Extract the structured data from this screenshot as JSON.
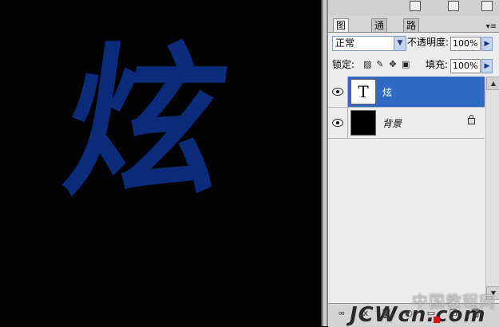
{
  "canvas": {
    "glyph": "炫"
  },
  "tabs": [
    {
      "label": "图层",
      "active": true,
      "close": "×"
    },
    {
      "label": "通道",
      "active": false
    },
    {
      "label": "路径",
      "active": false
    }
  ],
  "blend": {
    "mode": "正常"
  },
  "opacity": {
    "label": "不透明度:",
    "value": "100%"
  },
  "lock": {
    "label": "锁定:"
  },
  "fill": {
    "label": "填充:",
    "value": "100%"
  },
  "layers": [
    {
      "name": "炫",
      "thumb": "T",
      "selected": true
    },
    {
      "name": "背景",
      "selected": false
    }
  ],
  "watermark": {
    "cn": "中国教程网",
    "en": "JCWcn.com"
  },
  "icons": {
    "top": [
      "panel-menu-icon-1",
      "panel-menu-icon-2",
      "panel-menu-icon-3"
    ],
    "lock": [
      "lock-transparent-icon",
      "lock-image-icon",
      "lock-position-icon",
      "lock-all-icon"
    ],
    "bottom": [
      "link-layers-icon",
      "layer-style-icon",
      "layer-mask-icon",
      "adjustment-layer-icon",
      "new-group-icon",
      "new-layer-icon",
      "delete-layer-icon"
    ]
  },
  "colors": {
    "selected": "#2f6bc4",
    "glyph": "#0a2c7a"
  }
}
